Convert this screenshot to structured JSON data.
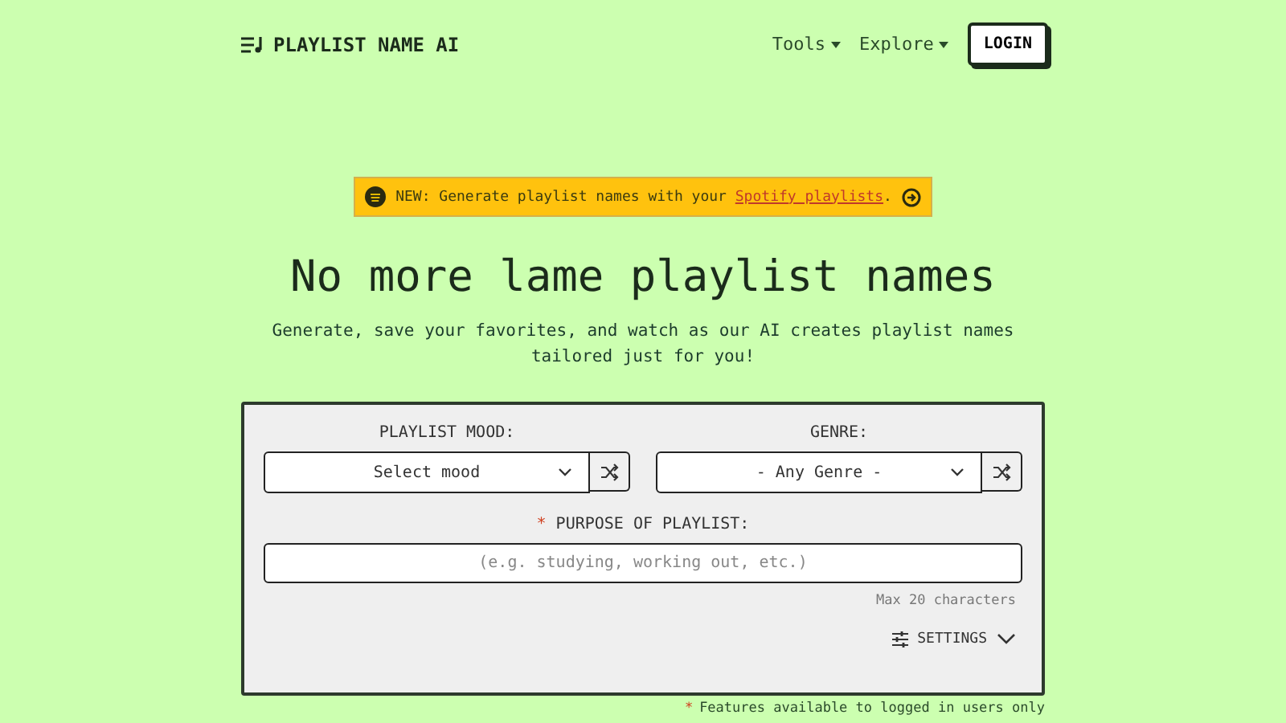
{
  "header": {
    "logo": "PLAYLIST NAME AI",
    "nav": [
      {
        "label": "Tools"
      },
      {
        "label": "Explore"
      }
    ],
    "login": "LOGIN"
  },
  "banner": {
    "badge": "NEW:",
    "text": "Generate playlist names with your",
    "link": "Spotify playlists",
    "end": "."
  },
  "hero": {
    "title": "No more lame playlist names",
    "subtitle": "Generate, save your favorites, and watch as our AI creates playlist names tailored just for you!"
  },
  "form": {
    "selects": [
      {
        "label": "PLAYLIST MOOD:",
        "value": "Select mood"
      },
      {
        "label": "GENRE:",
        "value": "- Any Genre -"
      }
    ],
    "purpose": {
      "required_mark": "*",
      "label": "PURPOSE OF PLAYLIST:",
      "placeholder": "(e.g. studying, working out, etc.)",
      "hint": "Max 20 characters"
    },
    "settings": {
      "label": "SETTINGS",
      "expanded": false
    }
  },
  "footnote": {
    "mark": "*",
    "text": "Features available to logged in users only"
  }
}
